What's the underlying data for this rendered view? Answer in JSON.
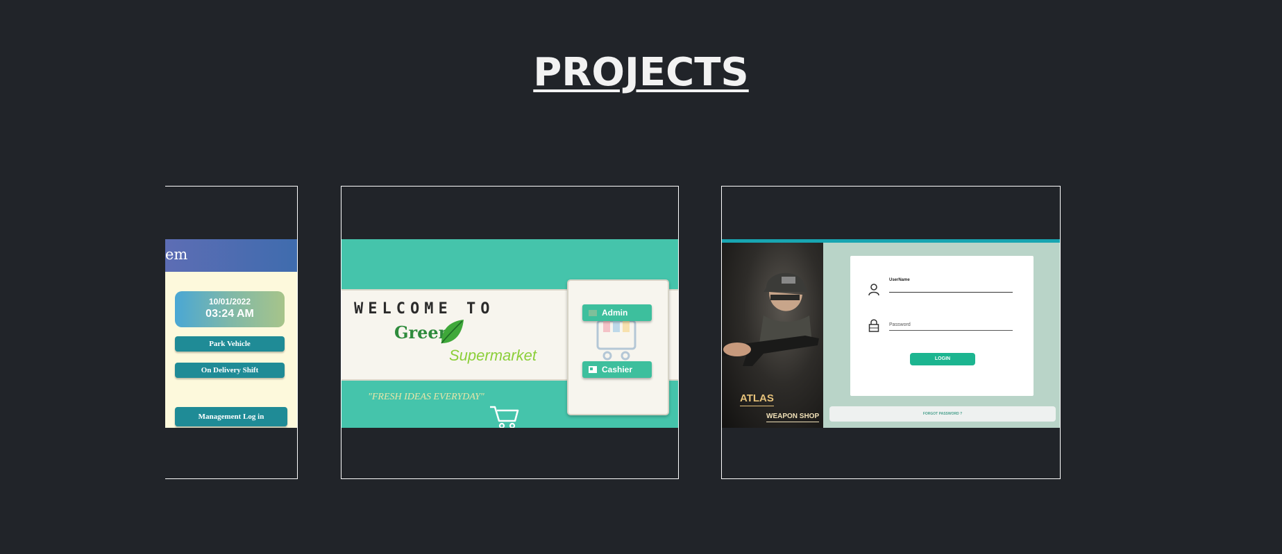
{
  "heading": "PROJECTS",
  "projects": [
    {
      "header_fragment": "em",
      "date": "10/01/2022",
      "time": "03:24 AM",
      "buttons": [
        "Park Vehicle",
        "On Delivery Shift",
        "Management Log in"
      ],
      "colors": {
        "header": "#4a6db1",
        "button": "#1f8b96",
        "background": "#fdf9dc"
      }
    },
    {
      "welcome": "WELCOME TO",
      "brand_green": "Green",
      "brand_super": "Supermarket",
      "slogan": "\"FRESH IDEAS EVERYDAY\"",
      "buttons": [
        "Admin",
        "Cashier"
      ],
      "colors": {
        "background": "#45c4ab",
        "accent": "#8ccf3a",
        "button": "#3dbf9d"
      }
    },
    {
      "brand": "ATLAS",
      "brand_sub": "WEAPON SHOP",
      "username_label": "UserName",
      "password_placeholder": "Password",
      "login_label": "LOGIN",
      "forgot_label": "FORGOT PASSWORD ?",
      "colors": {
        "background": "#b9d4c8",
        "button": "#1cb590",
        "top_bar": "#18a5b1"
      }
    }
  ]
}
